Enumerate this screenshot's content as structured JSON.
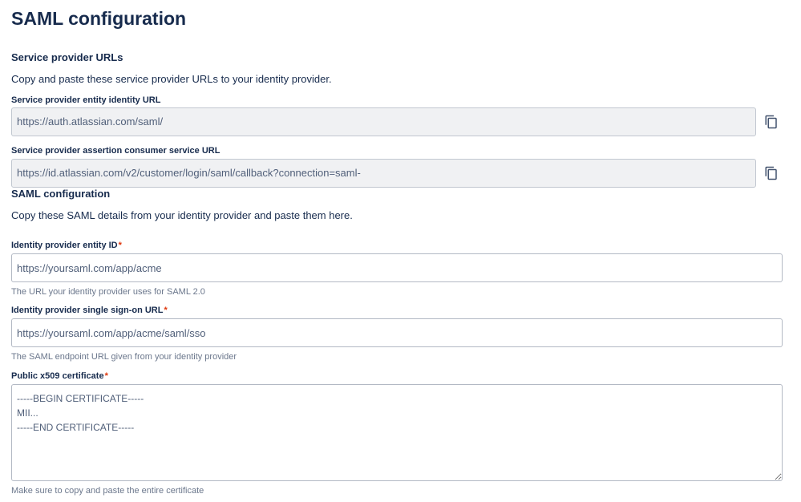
{
  "page": {
    "title": "SAML configuration"
  },
  "service_provider": {
    "heading": "Service provider URLs",
    "description": "Copy and paste these service provider URLs to your identity provider.",
    "entity_url": {
      "label": "Service provider entity identity URL",
      "value": "https://auth.atlassian.com/saml/",
      "copy_icon": "copy-icon"
    },
    "acs_url": {
      "label": "Service provider assertion consumer service URL",
      "value": "https://id.atlassian.com/v2/customer/login/saml/callback?connection=saml-",
      "copy_icon": "copy-icon"
    }
  },
  "saml": {
    "heading": "SAML configuration",
    "description": "Copy these SAML details from your identity provider and paste them here.",
    "required_marker": "*",
    "entity_id": {
      "label": "Identity provider entity ID",
      "placeholder": "https://yoursaml.com/app/acme",
      "helper": "The URL your identity provider uses for SAML 2.0"
    },
    "sso_url": {
      "label": "Identity provider single sign-on URL",
      "placeholder": "https://yoursaml.com/app/acme/saml/sso",
      "helper": "The SAML endpoint URL given from your identity provider"
    },
    "certificate": {
      "label": "Public x509 certificate",
      "placeholder": "-----BEGIN CERTIFICATE-----\nMII...\n-----END CERTIFICATE-----",
      "helper": "Make sure to copy and paste the entire certificate"
    }
  },
  "colors": {
    "text": "#172b4d",
    "required": "#de350b",
    "readonly_bg": "#f0f1f3",
    "helper_text": "#6b778c"
  }
}
